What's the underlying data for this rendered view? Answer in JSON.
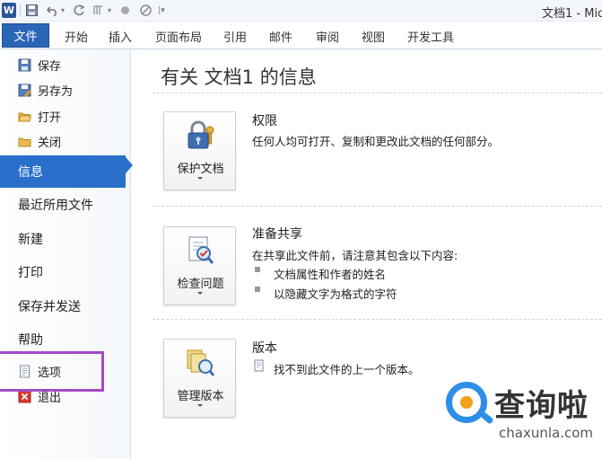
{
  "titlebar": {
    "app_logo": "W",
    "window_title": "文档1 - Mic",
    "qat_icons": [
      "save-icon",
      "undo-icon",
      "redo-icon",
      "format-painter-icon",
      "circle-icon",
      "no-entry-icon",
      "customize-qat-icon"
    ]
  },
  "ribbon": {
    "file_tab": "文件",
    "tabs": [
      "开始",
      "插入",
      "页面布局",
      "引用",
      "邮件",
      "审阅",
      "视图",
      "开发工具"
    ]
  },
  "backstage": {
    "commands_top": [
      "保存",
      "另存为",
      "打开",
      "关闭"
    ],
    "nav": [
      "信息",
      "最近所用文件",
      "新建",
      "打印",
      "保存并发送",
      "帮助"
    ],
    "commands_bottom": [
      "选项",
      "退出"
    ],
    "active_nav": "信息"
  },
  "info": {
    "title": "有关 文档1 的信息",
    "permissions": {
      "button_label": "保护文档",
      "heading": "权限",
      "text": "任何人均可打开、复制和更改此文档的任何部分。"
    },
    "prepare": {
      "button_label": "检查问题",
      "heading": "准备共享",
      "text": "在共享此文件前，请注意其包含以下内容:",
      "bullets": [
        "文档属性和作者的姓名",
        "以隐藏文字为格式的字符"
      ]
    },
    "versions": {
      "button_label": "管理版本",
      "heading": "版本",
      "text": "找不到此文件的上一个版本。"
    }
  },
  "watermark": {
    "brand": "查询啦",
    "url": "chaxunla.com"
  },
  "colors": {
    "accent_blue": "#2a6fc9",
    "file_tab": "#2a65b8",
    "highlight_purple": "#a34bc6"
  }
}
